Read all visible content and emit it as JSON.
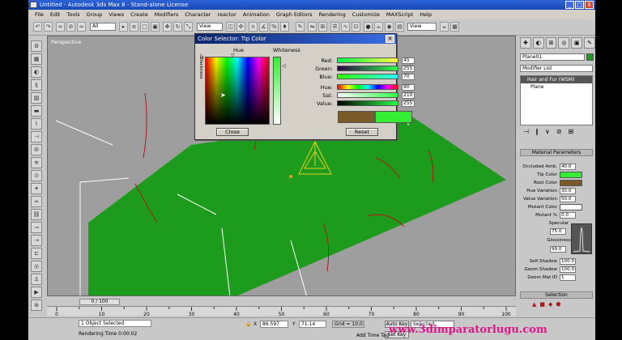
{
  "window": {
    "title": "Untitled   - Autodesk 3ds Max 8   - Stand-alone License",
    "minimize": "_",
    "maximize": "□",
    "close": "X"
  },
  "menu": [
    "File",
    "Edit",
    "Tools",
    "Group",
    "Views",
    "Create",
    "Modifiers",
    "Character",
    "reactor",
    "Animation",
    "Graph Editors",
    "Rendering",
    "Customize",
    "MAXScript",
    "Help"
  ],
  "toolbar": {
    "selection_filter": "All",
    "ref_coord": "View",
    "named_sel": "View"
  },
  "viewport": {
    "label": "Perspective"
  },
  "command_panel": {
    "object_name": "Plane01",
    "modifier_list": "Modifier List",
    "stack": [
      "Hair and Fur (WSM)",
      "Plane"
    ],
    "rollout_material": "Material Parameters",
    "params": [
      {
        "label": "Occluded Amb.",
        "value": "40.0"
      },
      {
        "label": "Tip Color",
        "value": ""
      },
      {
        "label": "Root Color",
        "value": ""
      },
      {
        "label": "Hue Variation",
        "value": "30.0"
      },
      {
        "label": "Value Variation",
        "value": "50.0"
      },
      {
        "label": "Mutant Color",
        "value": ""
      },
      {
        "label": "Mutant %",
        "value": "0.0"
      }
    ],
    "specular_label": "Specular",
    "specular_value": "75.0",
    "glossiness_label": "Glossiness",
    "glossiness_value": "99.0",
    "shadow_params": [
      {
        "label": "Self Shadow",
        "value": "100.0"
      },
      {
        "label": "Geom Shadow",
        "value": "100.0"
      },
      {
        "label": "Geom Mat ID",
        "value": "1"
      }
    ],
    "rollout_selection": "Selection",
    "tip_color": "#33ee33",
    "root_color": "#7a5a28",
    "mutant_color": "#ffffff"
  },
  "color_dialog": {
    "title": "Color Selector: Tip Color",
    "hue_label": "Hue",
    "whiteness_label": "Whiteness",
    "blackness_label": "Blackness",
    "channels": [
      {
        "label": "Red:",
        "value": "45"
      },
      {
        "label": "Green:",
        "value": "255"
      },
      {
        "label": "Blue:",
        "value": "70"
      },
      {
        "label": "Hue:",
        "value": "90"
      },
      {
        "label": "Sat:",
        "value": "210"
      },
      {
        "label": "Value:",
        "value": "255"
      }
    ],
    "close_label": "Close",
    "reset_label": "Reset",
    "old_color": "#7a5a28",
    "new_color": "#33ee33"
  },
  "timeline": {
    "frame_text": "0 / 100",
    "ticks": [
      "0",
      "10",
      "20",
      "30",
      "40",
      "50",
      "60",
      "70",
      "80",
      "90",
      "100"
    ]
  },
  "status": {
    "selected": "1 Object Selected",
    "render_time": "Rendering Time  0:00:02",
    "x_value": "86.597",
    "y_value": "71.14",
    "grid": "Grid = 10,0",
    "auto_key": "Auto Key",
    "selected_dropdown": "Selected",
    "add_time_tag": "Add Time Tag",
    "set_key": "Set Key"
  },
  "watermark": "www.3dimparatorlugu.com"
}
